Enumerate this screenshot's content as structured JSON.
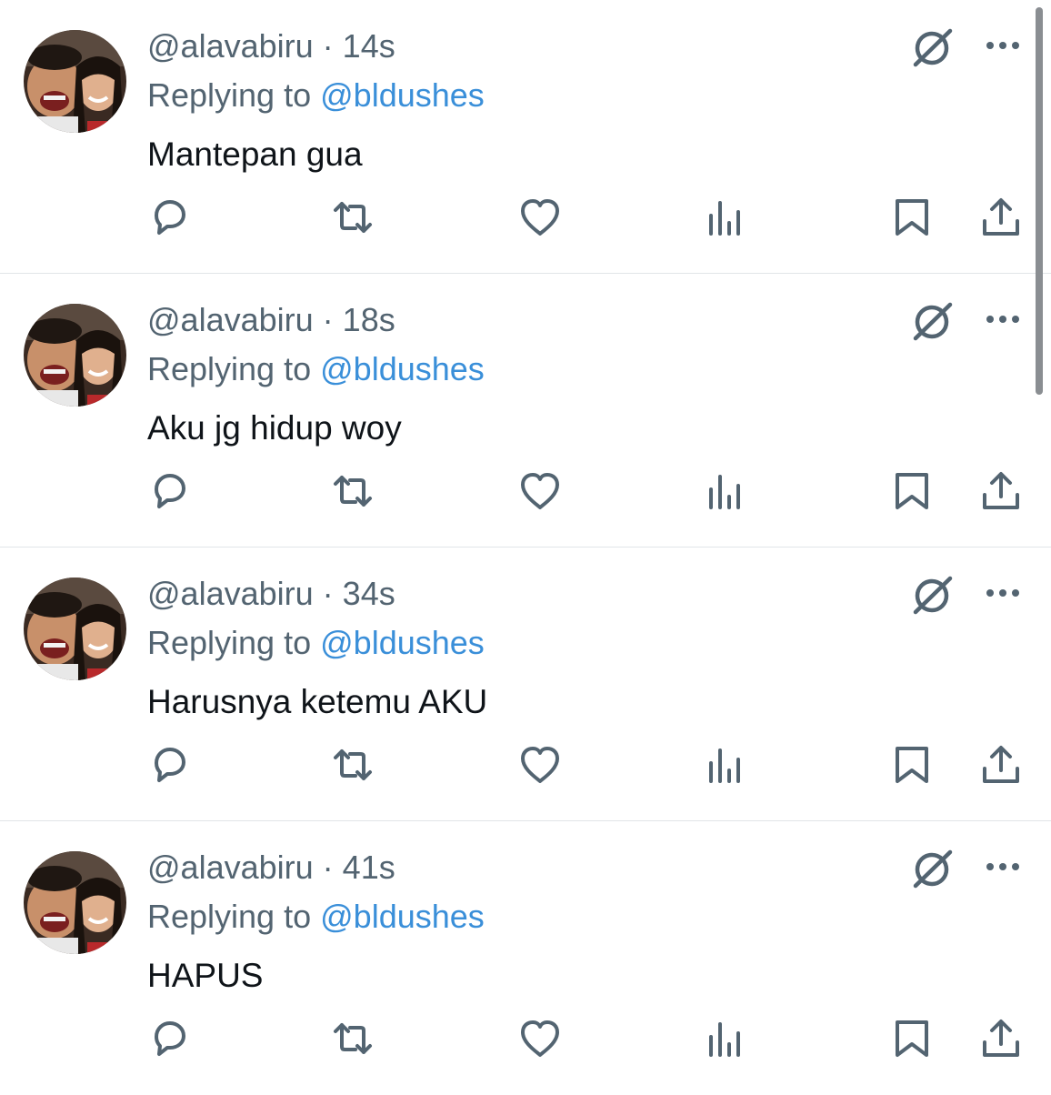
{
  "replies": [
    {
      "handle": "@alavabiru",
      "separator": "·",
      "time": "14s",
      "replying_prefix": "Replying to",
      "replying_to": "@bldushes",
      "text": "Mantepan gua"
    },
    {
      "handle": "@alavabiru",
      "separator": "·",
      "time": "18s",
      "replying_prefix": "Replying to",
      "replying_to": "@bldushes",
      "text": "Aku jg hidup woy"
    },
    {
      "handle": "@alavabiru",
      "separator": "·",
      "time": "34s",
      "replying_prefix": "Replying to",
      "replying_to": "@bldushes",
      "text": "Harusnya ketemu AKU"
    },
    {
      "handle": "@alavabiru",
      "separator": "·",
      "time": "41s",
      "replying_prefix": "Replying to",
      "replying_to": "@bldushes",
      "text": "HAPUS"
    }
  ],
  "icons": {
    "grok": "grok-icon",
    "more": "more-icon",
    "reply": "reply-icon",
    "retweet": "retweet-icon",
    "like": "heart-icon",
    "views": "views-icon",
    "bookmark": "bookmark-icon",
    "share": "share-icon"
  },
  "colors": {
    "text_primary": "#0f1419",
    "text_secondary": "#536471",
    "mention": "#3a8fd9",
    "icon": "#536471",
    "divider": "#e1e5e8"
  }
}
